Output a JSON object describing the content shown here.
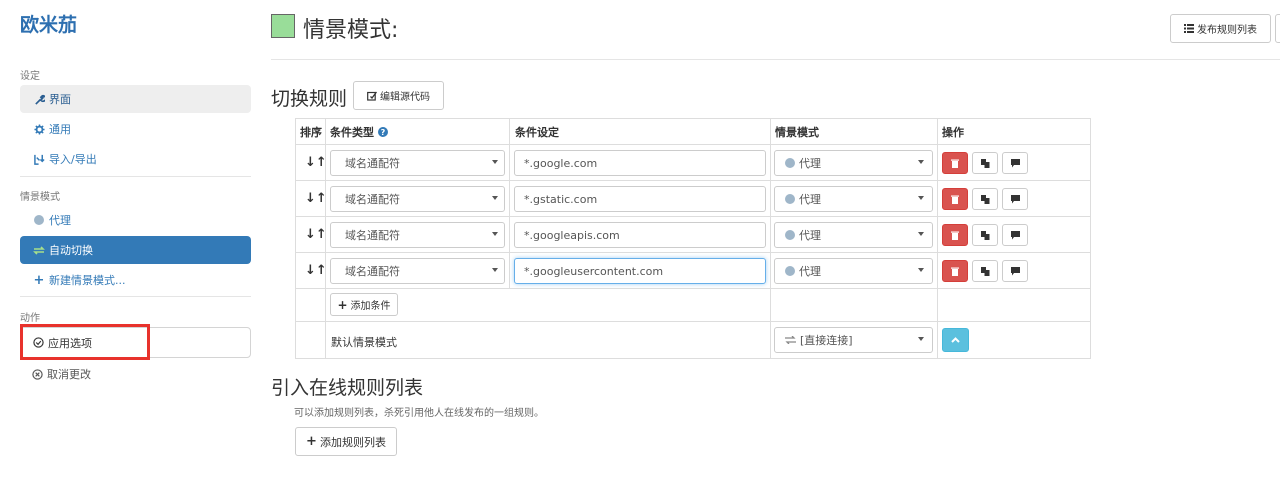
{
  "sidebar": {
    "brand": "欧米茄",
    "settings_label": "设定",
    "items_settings": [
      {
        "label": "界面",
        "icon": "wrench-icon"
      },
      {
        "label": "通用",
        "icon": "gear-icon"
      },
      {
        "label": "导入/导出",
        "icon": "import-export-icon"
      }
    ],
    "profiles_label": "情景模式",
    "items_profiles": [
      {
        "label": "代理",
        "icon": "globe-icon"
      },
      {
        "label": "自动切换",
        "icon": "switch-icon"
      },
      {
        "label": "新建情景模式...",
        "icon": "plus-icon"
      }
    ],
    "actions_label": "动作",
    "apply_label": "应用选项",
    "cancel_label": "取消更改"
  },
  "header": {
    "title": "情景模式:",
    "publish_label": "发布规则列表"
  },
  "switch_rules": {
    "title": "切换规则",
    "edit_source_label": "编辑源代码",
    "columns": [
      "排序",
      "条件类型",
      "条件设定",
      "情景模式",
      "操作"
    ],
    "rows": [
      {
        "condition_type": "域名通配符",
        "condition": "*.google.com",
        "profile": "代理"
      },
      {
        "condition_type": "域名通配符",
        "condition": "*.gstatic.com",
        "profile": "代理"
      },
      {
        "condition_type": "域名通配符",
        "condition": "*.googleapis.com",
        "profile": "代理"
      },
      {
        "condition_type": "域名通配符",
        "condition": "*.googleusercontent.com",
        "profile": "代理"
      }
    ],
    "add_condition_label": "添加条件",
    "default_label": "默认情景模式",
    "default_profile": "[直接连接]"
  },
  "online_rules": {
    "title": "引入在线规则列表",
    "hint": "可以添加规则列表，杀死引用他人在线发布的一组规则。",
    "add_label": "添加规则列表"
  },
  "colors": {
    "primary": "#337ab7",
    "danger": "#d9534f",
    "info": "#5bc0de",
    "profile_box": "#99dd99",
    "highlight": "#e8322c"
  }
}
